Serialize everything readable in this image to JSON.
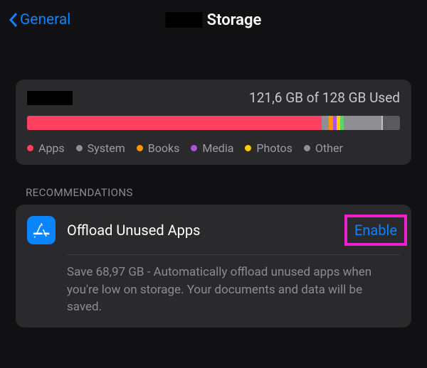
{
  "nav": {
    "back_label": "General",
    "title": "Storage"
  },
  "storage": {
    "used_text": "121,6 GB of 128 GB Used",
    "segments": [
      {
        "key": "apps",
        "label": "Apps",
        "color": "#ff4060",
        "fraction": 0.79
      },
      {
        "key": "system",
        "label": "System",
        "color": "#8e8e93",
        "fraction": 0.02
      },
      {
        "key": "books",
        "label": "Books",
        "color": "#ff9500",
        "fraction": 0.01
      },
      {
        "key": "media",
        "label": "Media",
        "color": "#af52de",
        "fraction": 0.01
      },
      {
        "key": "photos",
        "label": "Photos",
        "color": "#ffcc00",
        "fraction": 0.01
      },
      {
        "key": "other",
        "label": "Other",
        "color": "#57d66b",
        "fraction": 0.01
      },
      {
        "key": "fill1",
        "label": "",
        "color": "#8e8e93",
        "fraction": 0.1
      },
      {
        "key": "fill2",
        "label": "",
        "color": "#bfbfc3",
        "fraction": 0.005
      },
      {
        "key": "free",
        "label": "",
        "color": "#5a5a5e",
        "fraction": 0.045
      }
    ],
    "legend": [
      {
        "label": "Apps",
        "color": "#ff4060"
      },
      {
        "label": "System",
        "color": "#8e8e93"
      },
      {
        "label": "Books",
        "color": "#ff9500"
      },
      {
        "label": "Media",
        "color": "#af52de"
      },
      {
        "label": "Photos",
        "color": "#ffcc00"
      },
      {
        "label": "Other",
        "color": "#8e8e93"
      }
    ]
  },
  "recommendations": {
    "header": "RECOMMENDATIONS",
    "items": [
      {
        "title": "Offload Unused Apps",
        "action": "Enable",
        "description": "Save 68,97 GB - Automatically offload unused apps when you're low on storage. Your documents and data will be saved."
      }
    ]
  },
  "colors": {
    "accent": "#0a84ff",
    "highlight": "#f020d0"
  }
}
